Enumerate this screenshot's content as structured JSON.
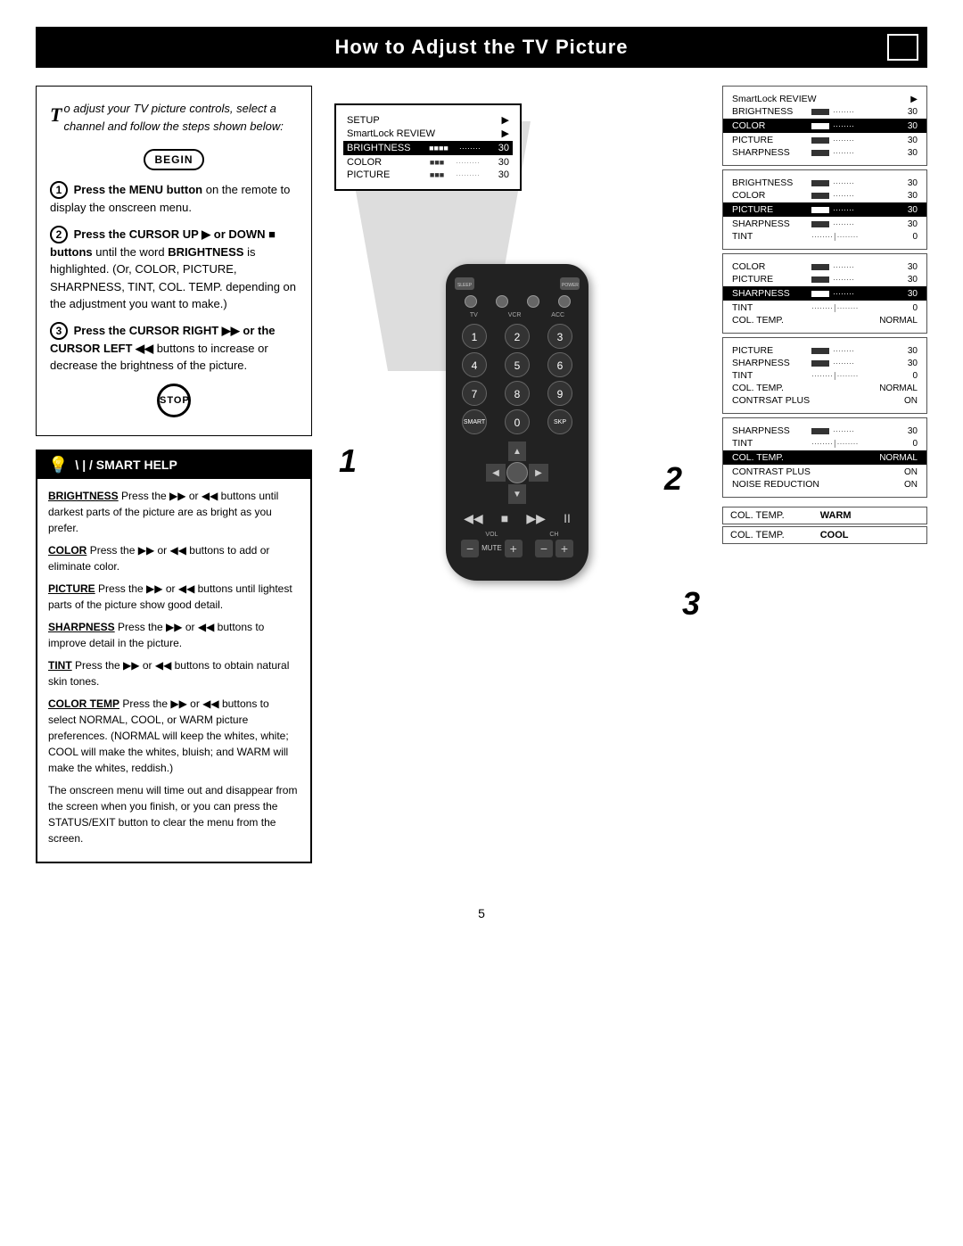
{
  "title": "How to Adjust the TV Picture",
  "intro": {
    "drop_cap": "T",
    "text": "o adjust your TV picture controls, select a channel and follow the steps shown below:"
  },
  "begin_label": "BEGIN",
  "stop_label": "STOP",
  "steps": [
    {
      "num": "1",
      "text": "Press the MENU button on the remote to display the onscreen menu."
    },
    {
      "num": "2",
      "label_bold": "Press the CURSOR UP ▶ or DOWN ■ buttons",
      "text": " until the word BRIGHTNESS is highlighted. (Or, COLOR, PICTURE, SHARPNESS, TINT, COL. TEMP. depending on the adjustment you want to make.)"
    },
    {
      "num": "3",
      "label_bold": "Press the CURSOR RIGHT ▶▶ or the CURSOR LEFT ◀◀",
      "text": " buttons to increase or decrease the brightness of the picture."
    }
  ],
  "smart_help": {
    "title": "Smart Help",
    "items": [
      {
        "label": "BRIGHTNESS",
        "text": " Press the ▶▶ or ◀◀ buttons until darkest parts of the picture are as bright as you prefer."
      },
      {
        "label": "COLOR",
        "text": " Press the ▶▶ or ◀◀ buttons to add or eliminate color."
      },
      {
        "label": "PICTURE",
        "text": " Press the ▶▶ or ◀◀ buttons until lightest parts of the picture show good detail."
      },
      {
        "label": "SHARPNESS",
        "text": " Press the ▶▶ or ◀◀ buttons to improve detail in the picture."
      },
      {
        "label": "TINT",
        "text": " Press the ▶▶ or ◀◀ buttons to obtain natural skin tones."
      },
      {
        "label": "COLOR TEMP",
        "text": " Press the ▶▶ or ◀◀ buttons to select NORMAL, COOL, or WARM picture preferences. (NORMAL will keep the whites, white; COOL will make the whites, bluish; and WARM will make the whites, reddish.)"
      }
    ],
    "closing": "The onscreen menu will time out and disappear from the screen when you finish, or you can press the STATUS/EXIT button to clear the menu from the screen."
  },
  "menu_screen_1": {
    "rows": [
      {
        "label": "SETUP",
        "value": "▶",
        "highlight": false
      },
      {
        "label": "SmartLock REVIEW",
        "value": "▶",
        "highlight": false
      },
      {
        "label": "BRIGHTNESS",
        "bar": true,
        "value": "30",
        "highlight": true
      },
      {
        "label": "COLOR",
        "bar": true,
        "value": "30",
        "highlight": false
      },
      {
        "label": "PICTURE",
        "bar": true,
        "value": "30",
        "highlight": false
      }
    ]
  },
  "right_menus": [
    {
      "rows": [
        {
          "label": "SmartLock REVIEW",
          "arrow": "▶",
          "highlight": false
        },
        {
          "label": "BRIGHTNESS",
          "bar": true,
          "value": "30",
          "highlight": false
        },
        {
          "label": "COLOR",
          "bar": true,
          "value": "30",
          "highlight": true
        },
        {
          "label": "PICTURE",
          "bar": true,
          "value": "30",
          "highlight": false
        },
        {
          "label": "SHARPNESS",
          "bar": true,
          "value": "30",
          "highlight": false
        }
      ]
    },
    {
      "rows": [
        {
          "label": "BRIGHTNESS",
          "bar": true,
          "value": "30",
          "highlight": false
        },
        {
          "label": "COLOR",
          "bar": true,
          "value": "30",
          "highlight": false
        },
        {
          "label": "PICTURE",
          "bar": true,
          "value": "30",
          "highlight": true
        },
        {
          "label": "SHARPNESS",
          "bar": true,
          "value": "30",
          "highlight": false
        },
        {
          "label": "TINT",
          "dots": true,
          "value": "0",
          "highlight": false
        }
      ]
    },
    {
      "rows": [
        {
          "label": "COLOR",
          "bar": true,
          "value": "30",
          "highlight": false
        },
        {
          "label": "PICTURE",
          "bar": true,
          "value": "30",
          "highlight": false
        },
        {
          "label": "SHARPNESS",
          "bar": true,
          "value": "30",
          "highlight": true
        },
        {
          "label": "TINT",
          "dots": true,
          "value": "0",
          "highlight": false
        },
        {
          "label": "COL. TEMP.",
          "text_value": "NORMAL",
          "highlight": false
        }
      ]
    },
    {
      "rows": [
        {
          "label": "PICTURE",
          "bar": true,
          "value": "30",
          "highlight": false
        },
        {
          "label": "SHARPNESS",
          "bar": true,
          "value": "30",
          "highlight": false
        },
        {
          "label": "TINT",
          "dots": true,
          "value": "0",
          "highlight": false
        },
        {
          "label": "COL. TEMP.",
          "text_value": "NORMAL",
          "highlight": false
        },
        {
          "label": "CONTRSAT PLUS",
          "text_value": "ON",
          "highlight": false
        }
      ]
    },
    {
      "rows": [
        {
          "label": "SHARPNESS",
          "bar": true,
          "value": "30",
          "highlight": false
        },
        {
          "label": "TINT",
          "dots": true,
          "value": "0",
          "highlight": false
        },
        {
          "label": "COL. TEMP.",
          "text_value": "NORMAL",
          "highlight": true
        },
        {
          "label": "CONTRAST PLUS",
          "text_value": "ON",
          "highlight": false
        },
        {
          "label": "NOISE REDUCTION",
          "text_value": "ON",
          "highlight": false
        }
      ]
    }
  ],
  "temp_boxes": [
    {
      "label": "COL. TEMP.",
      "value": "WARM"
    },
    {
      "label": "COL. TEMP.",
      "value": "COOL"
    }
  ],
  "remote": {
    "sleep_label": "SLEEP",
    "power_label": "POWER",
    "buttons": [
      "1",
      "2",
      "3",
      "4",
      "5",
      "6",
      "7",
      "8",
      "9",
      "SMART",
      "0",
      "CH"
    ]
  },
  "page_number": "5",
  "step_numbers": [
    "1",
    "2",
    "3"
  ]
}
